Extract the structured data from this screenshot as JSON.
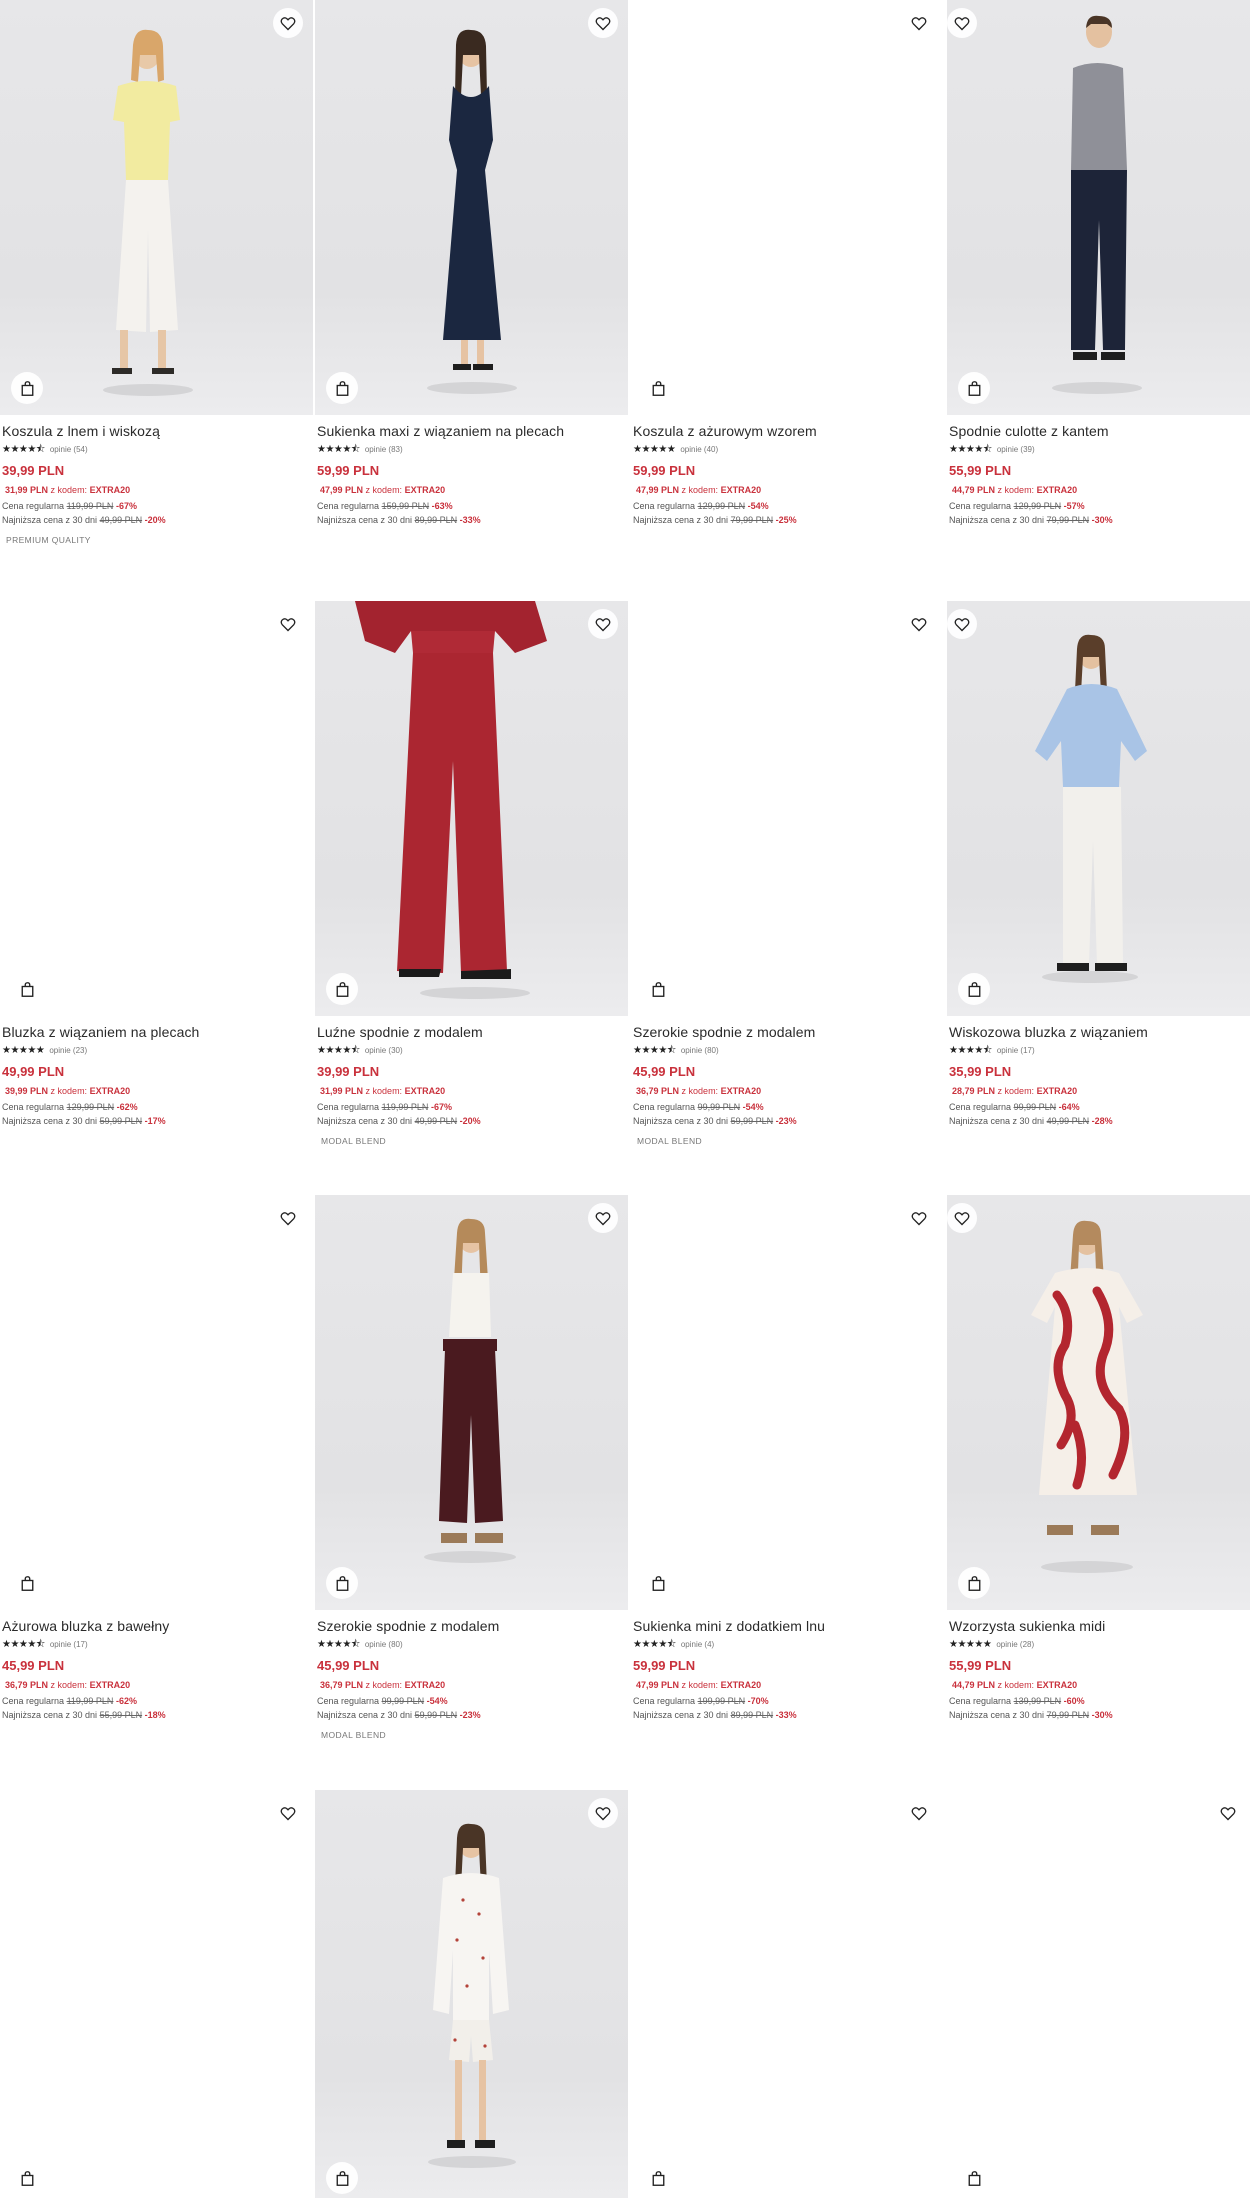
{
  "products": [
    {
      "id": "p1",
      "name": "Koszula z lnem i wiskozą",
      "stars": "★★★★⯪",
      "reviews": "opinie (54)",
      "price": "39,99 PLN",
      "promo_price": "31,99 PLN",
      "promo_label": "z kodem:",
      "promo_code": "EXTRA20",
      "regular_label": "Cena regularna",
      "regular_price": "119,99 PLN",
      "regular_disc": "-67%",
      "lowest_label": "Najniższa cena z 30 dni",
      "lowest_price": "49,99 PLN",
      "lowest_disc": "-20%",
      "tag": "PREMIUM QUALITY",
      "image": "photo"
    },
    {
      "id": "p2",
      "name": "Sukienka maxi z wiązaniem na plecach",
      "stars": "★★★★⯪",
      "reviews": "opinie (83)",
      "price": "59,99 PLN",
      "promo_price": "47,99 PLN",
      "promo_label": "z kodem:",
      "promo_code": "EXTRA20",
      "regular_label": "Cena regularna",
      "regular_price": "159,99 PLN",
      "regular_disc": "-63%",
      "lowest_label": "Najniższa cena z 30 dni",
      "lowest_price": "89,99 PLN",
      "lowest_disc": "-33%",
      "tag": "",
      "image": "photo"
    },
    {
      "id": "p3",
      "name": "Koszula z ażurowym wzorem",
      "stars": "★★★★★",
      "reviews": "opinie (40)",
      "price": "59,99 PLN",
      "promo_price": "47,99 PLN",
      "promo_label": "z kodem:",
      "promo_code": "EXTRA20",
      "regular_label": "Cena regularna",
      "regular_price": "129,99 PLN",
      "regular_disc": "-54%",
      "lowest_label": "Najniższa cena z 30 dni",
      "lowest_price": "79,99 PLN",
      "lowest_disc": "-25%",
      "tag": "",
      "image": "blank"
    },
    {
      "id": "p4",
      "name": "Spodnie culotte z kantem",
      "stars": "★★★★⯪",
      "reviews": "opinie (39)",
      "price": "55,99 PLN",
      "promo_price": "44,79 PLN",
      "promo_label": "z kodem:",
      "promo_code": "EXTRA20",
      "regular_label": "Cena regularna",
      "regular_price": "129,99 PLN",
      "regular_disc": "-57%",
      "lowest_label": "Najniższa cena z 30 dni",
      "lowest_price": "79,99 PLN",
      "lowest_disc": "-30%",
      "tag": "",
      "image": "photo"
    },
    {
      "id": "p5",
      "name": "Bluzka z wiązaniem na plecach",
      "stars": "★★★★★",
      "reviews": "opinie (23)",
      "price": "49,99 PLN",
      "promo_price": "39,99 PLN",
      "promo_label": "z kodem:",
      "promo_code": "EXTRA20",
      "regular_label": "Cena regularna",
      "regular_price": "129,99 PLN",
      "regular_disc": "-62%",
      "lowest_label": "Najniższa cena z 30 dni",
      "lowest_price": "59,99 PLN",
      "lowest_disc": "-17%",
      "tag": "",
      "image": "blank"
    },
    {
      "id": "p6",
      "name": "Luźne spodnie z modalem",
      "stars": "★★★★⯪",
      "reviews": "opinie (30)",
      "price": "39,99 PLN",
      "promo_price": "31,99 PLN",
      "promo_label": "z kodem:",
      "promo_code": "EXTRA20",
      "regular_label": "Cena regularna",
      "regular_price": "119,99 PLN",
      "regular_disc": "-67%",
      "lowest_label": "Najniższa cena z 30 dni",
      "lowest_price": "49,99 PLN",
      "lowest_disc": "-20%",
      "tag": "MODAL BLEND",
      "image": "photo"
    },
    {
      "id": "p7",
      "name": "Szerokie spodnie z modalem",
      "stars": "★★★★⯪",
      "reviews": "opinie (80)",
      "price": "45,99 PLN",
      "promo_price": "36,79 PLN",
      "promo_label": "z kodem:",
      "promo_code": "EXTRA20",
      "regular_label": "Cena regularna",
      "regular_price": "99,99 PLN",
      "regular_disc": "-54%",
      "lowest_label": "Najniższa cena z 30 dni",
      "lowest_price": "59,99 PLN",
      "lowest_disc": "-23%",
      "tag": "MODAL BLEND",
      "image": "blank"
    },
    {
      "id": "p8",
      "name": "Wiskozowa bluzka z wiązaniem",
      "stars": "★★★★⯪",
      "reviews": "opinie (17)",
      "price": "35,99 PLN",
      "promo_price": "28,79 PLN",
      "promo_label": "z kodem:",
      "promo_code": "EXTRA20",
      "regular_label": "Cena regularna",
      "regular_price": "99,99 PLN",
      "regular_disc": "-64%",
      "lowest_label": "Najniższa cena z 30 dni",
      "lowest_price": "49,99 PLN",
      "lowest_disc": "-28%",
      "tag": "",
      "image": "photo"
    },
    {
      "id": "p9",
      "name": "Ażurowa bluzka z bawełny",
      "stars": "★★★★⯪",
      "reviews": "opinie (17)",
      "price": "45,99 PLN",
      "promo_price": "36,79 PLN",
      "promo_label": "z kodem:",
      "promo_code": "EXTRA20",
      "regular_label": "Cena regularna",
      "regular_price": "119,99 PLN",
      "regular_disc": "-62%",
      "lowest_label": "Najniższa cena z 30 dni",
      "lowest_price": "55,99 PLN",
      "lowest_disc": "-18%",
      "tag": "",
      "image": "blank"
    },
    {
      "id": "p10",
      "name": "Szerokie spodnie z modalem",
      "stars": "★★★★⯪",
      "reviews": "opinie (80)",
      "price": "45,99 PLN",
      "promo_price": "36,79 PLN",
      "promo_label": "z kodem:",
      "promo_code": "EXTRA20",
      "regular_label": "Cena regularna",
      "regular_price": "99,99 PLN",
      "regular_disc": "-54%",
      "lowest_label": "Najniższa cena z 30 dni",
      "lowest_price": "59,99 PLN",
      "lowest_disc": "-23%",
      "tag": "MODAL BLEND",
      "image": "photo"
    },
    {
      "id": "p11",
      "name": "Sukienka mini z dodatkiem lnu",
      "stars": "★★★★⯪",
      "reviews": "opinie (4)",
      "price": "59,99 PLN",
      "promo_price": "47,99 PLN",
      "promo_label": "z kodem:",
      "promo_code": "EXTRA20",
      "regular_label": "Cena regularna",
      "regular_price": "199,99 PLN",
      "regular_disc": "-70%",
      "lowest_label": "Najniższa cena z 30 dni",
      "lowest_price": "89,99 PLN",
      "lowest_disc": "-33%",
      "tag": "",
      "image": "blank"
    },
    {
      "id": "p12",
      "name": "Wzorzysta sukienka midi",
      "stars": "★★★★★",
      "reviews": "opinie (28)",
      "price": "55,99 PLN",
      "promo_price": "44,79 PLN",
      "promo_label": "z kodem:",
      "promo_code": "EXTRA20",
      "regular_label": "Cena regularna",
      "regular_price": "139,99 PLN",
      "regular_disc": "-60%",
      "lowest_label": "Najniższa cena z 30 dni",
      "lowest_price": "79,99 PLN",
      "lowest_disc": "-30%",
      "tag": "",
      "image": "photo"
    },
    {
      "id": "p13",
      "image": "blank"
    },
    {
      "id": "p14",
      "image": "photo"
    },
    {
      "id": "p15",
      "image": "blank"
    },
    {
      "id": "p16",
      "image": "blank"
    }
  ],
  "icons": {
    "favorite": "heart-icon",
    "cart": "shopping-bag-icon"
  },
  "colors": {
    "price_red": "#c9313c",
    "text": "#2a2a2a",
    "muted": "#777777",
    "photo_bg": "#e5e5e7"
  }
}
